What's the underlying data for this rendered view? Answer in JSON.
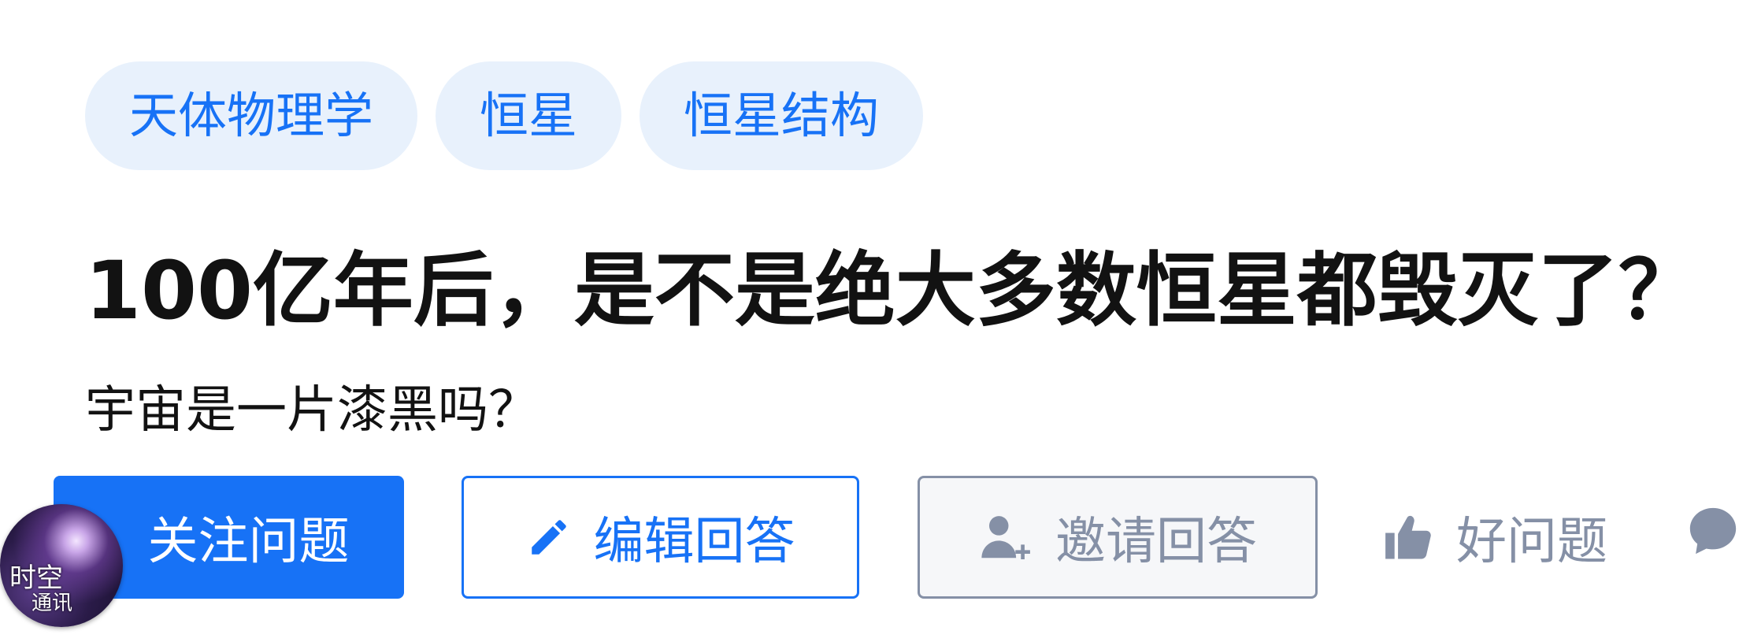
{
  "topics": [
    {
      "label": "天体物理学"
    },
    {
      "label": "恒星"
    },
    {
      "label": "恒星结构"
    }
  ],
  "question": {
    "title": "100亿年后，是不是绝大多数恒星都毁灭了？",
    "detail": "宇宙是一片漆黑吗？"
  },
  "actions": {
    "follow_label": "关注问题",
    "edit_label": "编辑回答",
    "invite_label": "邀请回答",
    "good_label": "好问题"
  },
  "avatar": {
    "line1": "时空",
    "line2": "通讯"
  },
  "colors": {
    "brand_blue": "#1772f6",
    "tag_bg": "#e8f1fc",
    "muted_gray": "#8590a6",
    "title_text": "#121212"
  },
  "icons": {
    "edit": "pencil-icon",
    "invite": "add-user-icon",
    "good": "thumbs-up-icon",
    "comment": "comment-bubble-icon"
  }
}
